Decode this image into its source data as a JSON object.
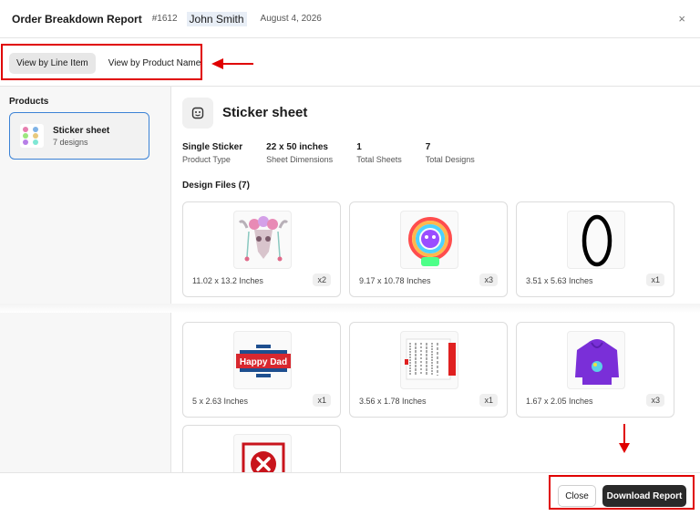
{
  "header": {
    "title": "Order Breakdown Report",
    "order_number": "#1612",
    "customer": "John Smith",
    "date": "August 4, 2026",
    "close_glyph": "×"
  },
  "view_toggle": {
    "by_line_item": "View by Line Item",
    "by_product_name": "View by Product Name",
    "active": "by_line_item"
  },
  "sidebar": {
    "title": "Products",
    "products": [
      {
        "name": "Sticker sheet",
        "subtitle": "7 designs",
        "selected": true
      }
    ]
  },
  "main": {
    "icon": "sticker-icon",
    "title": "Sticker sheet",
    "stats": [
      {
        "value": "Single Sticker",
        "label": "Product Type"
      },
      {
        "value": "22 x 50 inches",
        "label": "Sheet Dimensions"
      },
      {
        "value": "1",
        "label": "Total Sheets"
      },
      {
        "value": "7",
        "label": "Total Designs"
      }
    ],
    "design_files_title": "Design Files (7)",
    "designs": [
      {
        "size": "11.02 x 13.2 Inches",
        "qty": "x2",
        "thumb": "floral-bull-skull-icon"
      },
      {
        "size": "9.17 x 10.78 Inches",
        "qty": "x3",
        "thumb": "rainbow-astronaut-icon"
      },
      {
        "size": "3.51 x 5.63 Inches",
        "qty": "x1",
        "thumb": "black-oval-ring-icon"
      },
      {
        "size": "5 x 2.63 Inches",
        "qty": "x1",
        "thumb": "happy-dad-badge-icon"
      },
      {
        "size": "3.56 x 1.78 Inches",
        "qty": "x1",
        "thumb": "text-label-sticker-icon"
      },
      {
        "size": "1.67 x 2.05 Inches",
        "qty": "x3",
        "thumb": "purple-hoodie-icon"
      },
      {
        "size": "",
        "qty": "",
        "thumb": "error-x-icon"
      }
    ],
    "badge_text": "Happy Dad"
  },
  "footer": {
    "close_label": "Close",
    "download_label": "Download Report"
  },
  "colors": {
    "annotation_red": "#e00000",
    "selected_border": "#3b82d6",
    "primary_button": "#2a2a2a"
  }
}
